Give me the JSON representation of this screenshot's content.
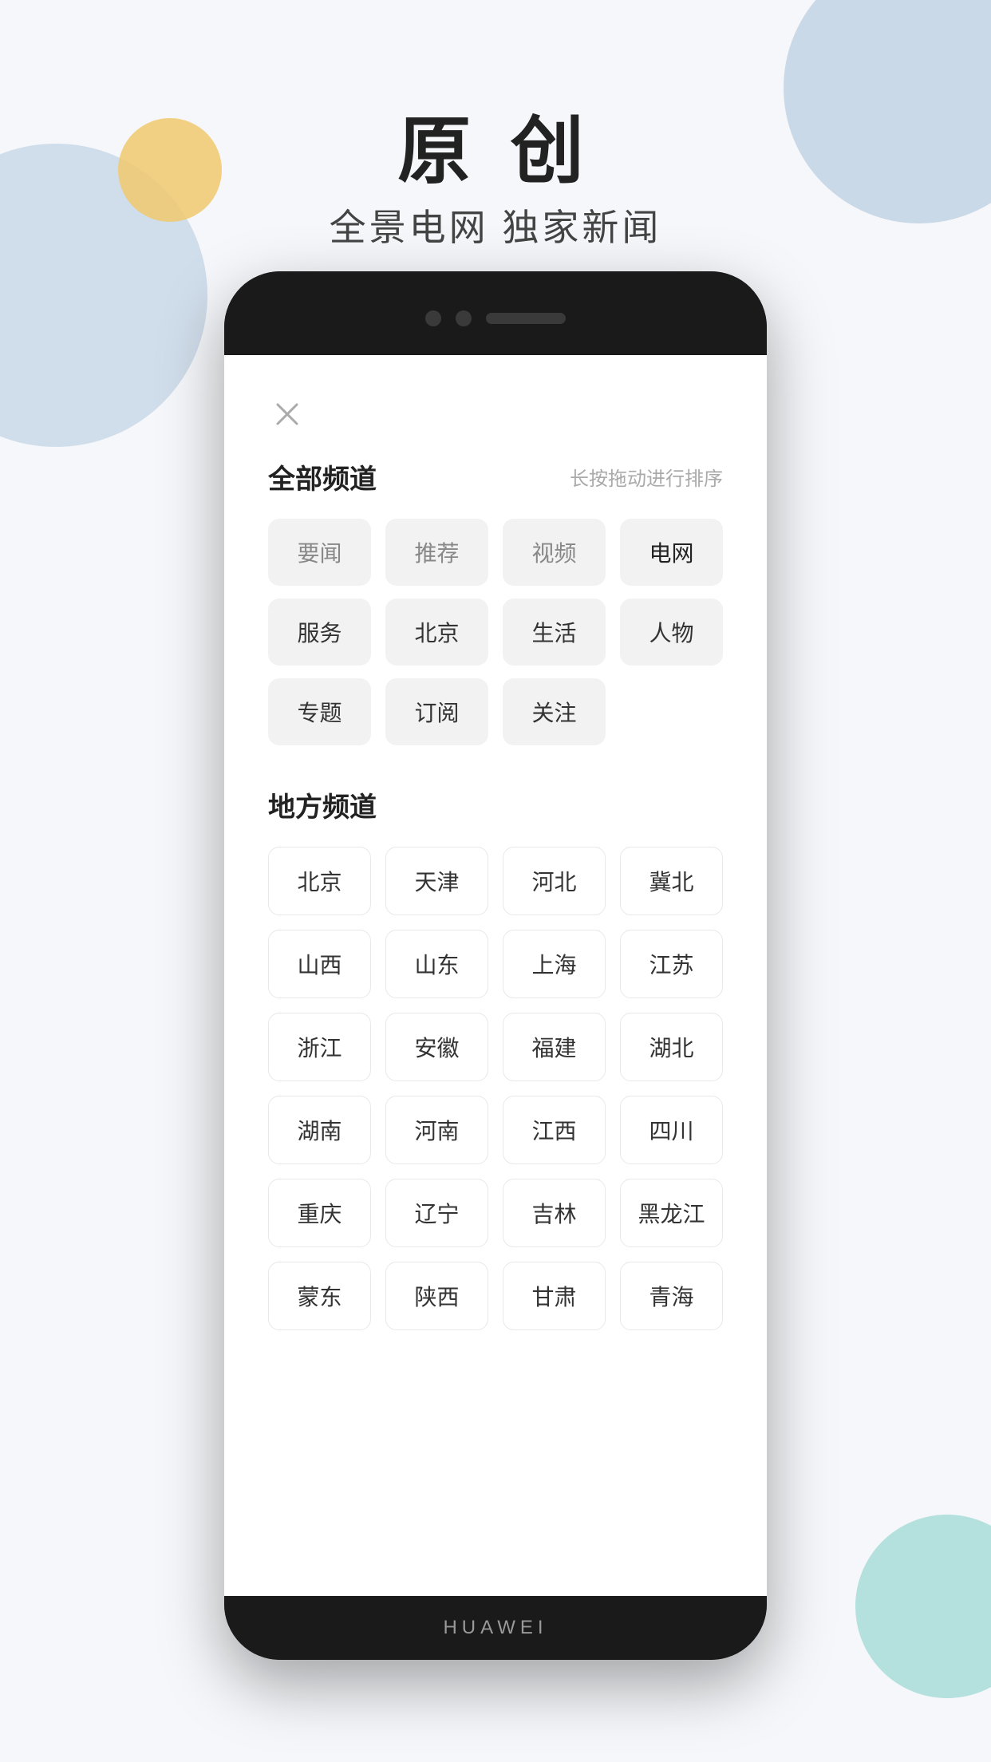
{
  "background": {
    "circles": {
      "topRight": {
        "color": "#b8ccdf"
      },
      "left": {
        "color": "#b8ccdf"
      },
      "yellow": {
        "color": "#f0c96e"
      },
      "tealBottomRight": {
        "color": "#7ecdc4"
      }
    }
  },
  "title": {
    "main": "原 创",
    "sub": "全景电网 独家新闻"
  },
  "phone": {
    "brand": "HUAWEI",
    "screen": {
      "close_btn_label": "×",
      "all_channels": {
        "title": "全部频道",
        "hint": "长按拖动进行排序",
        "rows": [
          [
            {
              "label": "要闻",
              "style": "muted"
            },
            {
              "label": "推荐",
              "style": "muted"
            },
            {
              "label": "视频",
              "style": "muted"
            },
            {
              "label": "电网",
              "style": "highlighted"
            }
          ],
          [
            {
              "label": "服务",
              "style": "normal"
            },
            {
              "label": "北京",
              "style": "normal"
            },
            {
              "label": "生活",
              "style": "normal"
            },
            {
              "label": "人物",
              "style": "normal"
            }
          ],
          [
            {
              "label": "专题",
              "style": "normal"
            },
            {
              "label": "订阅",
              "style": "normal"
            },
            {
              "label": "关注",
              "style": "normal"
            }
          ]
        ]
      },
      "local_channels": {
        "title": "地方频道",
        "rows": [
          [
            "北京",
            "天津",
            "河北",
            "冀北"
          ],
          [
            "山西",
            "山东",
            "上海",
            "江苏"
          ],
          [
            "浙江",
            "安徽",
            "福建",
            "湖北"
          ],
          [
            "湖南",
            "河南",
            "江西",
            "四川"
          ],
          [
            "重庆",
            "辽宁",
            "吉林",
            "黑龙江"
          ],
          [
            "蒙东",
            "陕西",
            "甘肃",
            "青海"
          ]
        ]
      }
    }
  }
}
